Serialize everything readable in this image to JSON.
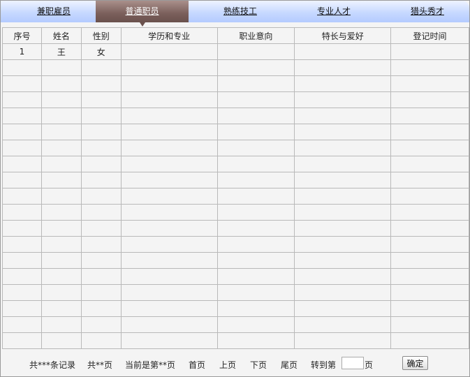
{
  "tabs": [
    {
      "label": "兼职雇员",
      "active": false
    },
    {
      "label": "普通职员",
      "active": true
    },
    {
      "label": "熟练技工",
      "active": false
    },
    {
      "label": "专业人才",
      "active": false
    },
    {
      "label": "猎头秀才",
      "active": false
    }
  ],
  "table": {
    "columns": [
      "序号",
      "姓名",
      "性别",
      "学历和专业",
      "职业意向",
      "特长与爱好",
      "登记时间"
    ],
    "rows": [
      [
        "1",
        "王",
        "女",
        "",
        "",
        "",
        ""
      ]
    ],
    "empty_row_count": 18
  },
  "pager": {
    "total_records": "共***条记录",
    "total_pages": "共**页",
    "current_page": "当前是第**页",
    "first": "首页",
    "prev": "上页",
    "next": "下页",
    "last": "尾页",
    "goto_prefix": "转到第",
    "goto_suffix": "页",
    "goto_value": "",
    "confirm": "确定"
  },
  "colors": {
    "tabbar_light": "#eef3ff",
    "tabbar_dark": "#b4cbff",
    "active_tab": "#7a5f5b",
    "grid_border": "#b9b9b9"
  }
}
